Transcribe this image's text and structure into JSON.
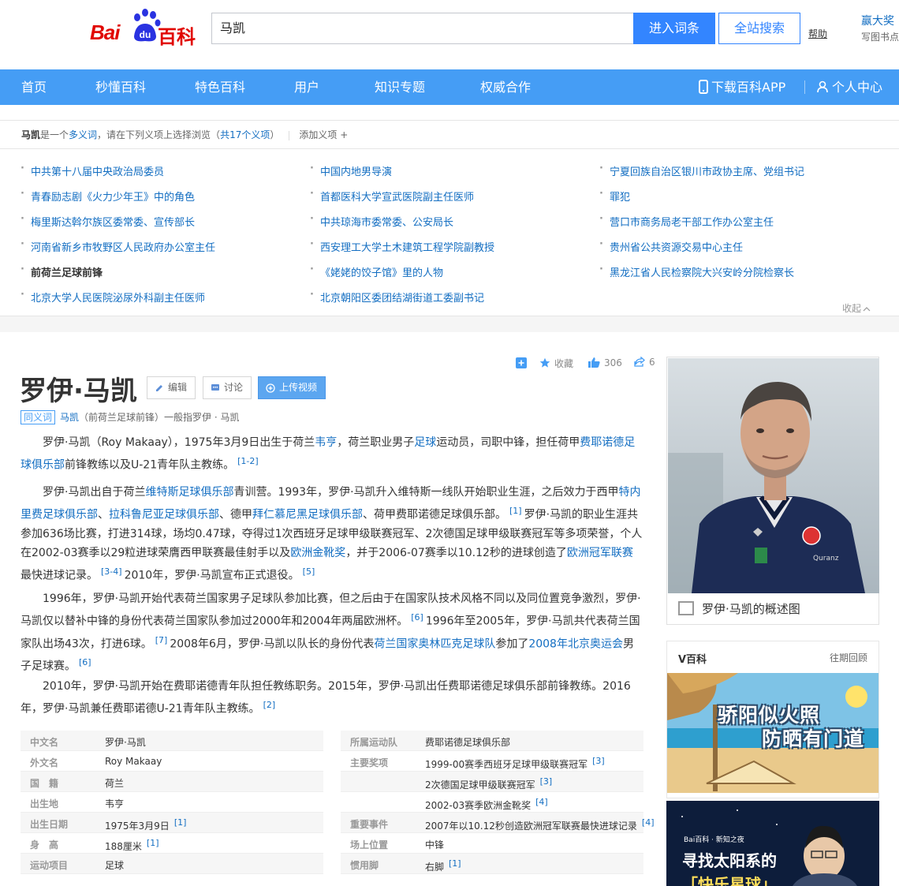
{
  "header": {
    "logo_bai": "Bai",
    "logo_du": "du",
    "logo_baike": "百科",
    "search_value": "马凯",
    "enter_label": "进入词条",
    "all_search_label": "全站搜索",
    "help_label": "帮助",
    "promo_title": "赢大奖",
    "promo_sub": "写图书点"
  },
  "nav": {
    "items": [
      "首页",
      "秒懂百科",
      "特色百科",
      "用户",
      "知识专题",
      "权威合作"
    ],
    "download_app": "下载百科APP",
    "personal_center": "个人中心"
  },
  "polysemy": {
    "term": "马凯",
    "desc_prefix": "是一个",
    "desc_link": "多义词",
    "desc_suffix": "，请在下列义项上选择浏览（",
    "count_link": "共17个义项",
    "desc_end": "）",
    "add_sense": "添加义项",
    "add_plus": "+",
    "collapse": "收起",
    "items": [
      "中共第十八届中央政治局委员",
      "中国内地男导演",
      "宁夏回族自治区银川市政协主席、党组书记",
      "青春励志剧《火力少年王》中的角色",
      "首都医科大学宣武医院副主任医师",
      "罪犯",
      "梅里斯达斡尔族区委常委、宣传部长",
      "中共琼海市委常委、公安局长",
      "营口市商务局老干部工作办公室主任",
      "河南省新乡市牧野区人民政府办公室主任",
      "西安理工大学土木建筑工程学院副教授",
      "贵州省公共资源交易中心主任",
      "前荷兰足球前锋",
      "《姥姥的饺子馆》里的人物",
      "黑龙江省人民检察院大兴安岭分院检察长",
      "北京大学人民医院泌尿外科副主任医师",
      "北京朝阳区委团结湖街道工委副书记"
    ]
  },
  "article": {
    "title": "罗伊·马凯",
    "edit": "编辑",
    "discuss": "讨论",
    "upload_video": "上传视频",
    "favorite": "收藏",
    "likes": "306",
    "shares": "6",
    "synonym_tag": "同义词",
    "synonym_link": "马凯",
    "synonym_text": "（前荷兰足球前锋）一般指罗伊 · 马凯",
    "p1": {
      "a": "罗伊·马凯（Roy Makaay），1975年3月9日出生于荷兰",
      "l1": "韦亨",
      "b": "，荷兰职业男子",
      "l2": "足球",
      "c": "运动员，司职中锋，担任荷甲",
      "l3": "费耶诺德足球俱乐部",
      "d": "前锋教练以及U-21青年队主教练。",
      "ref1": "[1-2]"
    },
    "p2": {
      "a": "罗伊·马凯出自于荷兰",
      "l1": "维特斯足球俱乐部",
      "b": "青训营。1993年，罗伊·马凯升入维特斯一线队开始职业生涯，之后效力于西甲",
      "l2": "特内里费足球俱乐部",
      "c": "、",
      "l3": "拉科鲁尼亚足球俱乐部",
      "d": "、德甲",
      "l4": "拜仁慕尼黑足球俱乐部",
      "e": "、荷甲费耶诺德足球俱乐部。",
      "ref1": "[1]",
      "f": "罗伊·马凯的职业生涯共参加636场比赛，打进314球，场均0.47球，夺得过1次西班牙足球甲级联赛冠军、2次德国足球甲级联赛冠军等多项荣誉，个人在2002-03赛季以29粒进球荣膺西甲联赛最佳射手以及",
      "l5": "欧洲金靴奖",
      "g": "，并于2006-07赛季以10.12秒的进球创造了",
      "l6": "欧洲冠军联赛",
      "h": "最快进球记录。",
      "ref2": "[3-4]",
      "i": "2010年，罗伊·马凯宣布正式退役。",
      "ref3": "[5]"
    },
    "p3": {
      "a": "1996年，罗伊·马凯开始代表荷兰国家男子足球队参加比赛，但之后由于在国家队技术风格不同以及同位置竞争激烈，罗伊·马凯仅以替补中锋的身份代表荷兰国家队参加过2000年和2004年两届欧洲杯。",
      "ref1": "[6]",
      "b": "1996年至2005年，罗伊·马凯共代表荷兰国家队出场43次，打进6球。",
      "ref2": "[7]",
      "c": "2008年6月，罗伊·马凯以队长的身份代表",
      "l1": "荷兰国家奥林匹克足球队",
      "d": "参加了",
      "l2": "2008年北京奥运会",
      "e": "男子足球赛。",
      "ref3": "[6]"
    },
    "p4": {
      "a": "2010年，罗伊·马凯开始在费耶诺德青年队担任教练职务。2015年，罗伊·马凯出任费耶诺德足球俱乐部前锋教练。2016年，罗伊·马凯兼任费耶诺德U-21青年队主教练。",
      "ref1": "[2]"
    }
  },
  "basic_info": {
    "left": [
      {
        "k": "中文名",
        "v": "罗伊·马凯",
        "ref": ""
      },
      {
        "k": "外文名",
        "v": "Roy Makaay",
        "ref": ""
      },
      {
        "k": "国　籍",
        "v": "荷兰",
        "ref": ""
      },
      {
        "k": "出生地",
        "v": "韦亨",
        "ref": ""
      },
      {
        "k": "出生日期",
        "v": "1975年3月9日",
        "ref": "[1]"
      },
      {
        "k": "身　高",
        "v": "188厘米",
        "ref": "[1]"
      },
      {
        "k": "运动项目",
        "v": "足球",
        "ref": ""
      }
    ],
    "right": [
      {
        "k": "所属运动队",
        "v": "费耶诺德足球俱乐部",
        "ref": ""
      },
      {
        "k": "主要奖项",
        "v": "1999-00赛季西班牙足球甲级联赛冠军",
        "ref": "[3]"
      },
      {
        "k": "",
        "v": "2次德国足球甲级联赛冠军",
        "ref": "[3]"
      },
      {
        "k": "",
        "v": "2002-03赛季欧洲金靴奖",
        "ref": "[4]"
      },
      {
        "k": "重要事件",
        "v": "2007年以10.12秒创造欧洲冠军联赛最快进球记录",
        "ref": "[4]"
      },
      {
        "k": "场上位置",
        "v": "中锋",
        "ref": ""
      },
      {
        "k": "惯用脚",
        "v": "右脚",
        "ref": "[1]"
      }
    ]
  },
  "sidebar": {
    "summary_caption": "罗伊·马凯的概述图",
    "jersey_text": "Quranz",
    "vbaike_title": "V百科",
    "vbaike_more": "往期回顾",
    "vbaike_line1": "骄阳似火照",
    "vbaike_line2": "防晒有门道",
    "ad_brand": "Bai百科 · 新知之夜",
    "ad_line1": "寻找太阳系的",
    "ad_line2": "「快乐星球」"
  }
}
